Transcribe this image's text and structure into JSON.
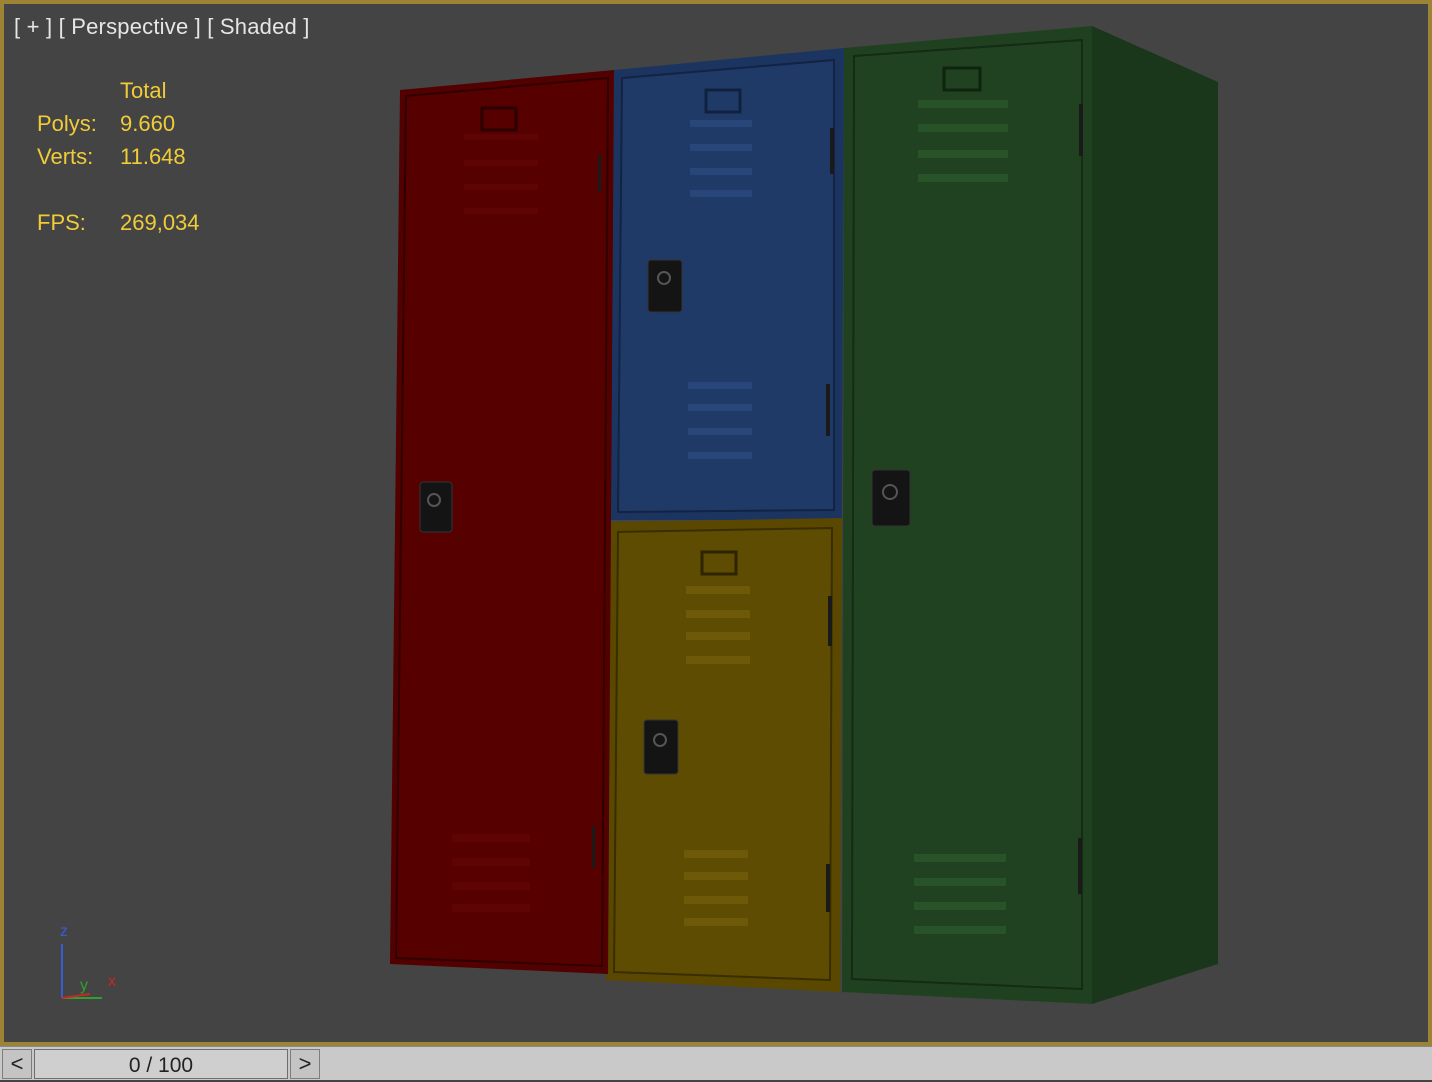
{
  "viewport": {
    "label": "[ + ] [ Perspective ] [ Shaded ]",
    "border_color": "#9c8436",
    "background": "#444444"
  },
  "stats": {
    "header": "Total",
    "polys_label": "Polys:",
    "polys_value": "9.660",
    "verts_label": "Verts:",
    "verts_value": "11.648",
    "fps_label": "FPS:",
    "fps_value": "269,034",
    "color": "#f0cc38"
  },
  "scene": {
    "object": "lockers",
    "locker_colors": {
      "red": "#560000",
      "blue": "#1e3560",
      "yellow": "#5c4a00",
      "green": "#1d3c1d"
    }
  },
  "axis_gizmo": {
    "z_label": "z",
    "y_label": "y",
    "x_label": "x"
  },
  "timebar": {
    "prev_label": "<",
    "next_label": ">",
    "frame_display": "0 / 100"
  }
}
